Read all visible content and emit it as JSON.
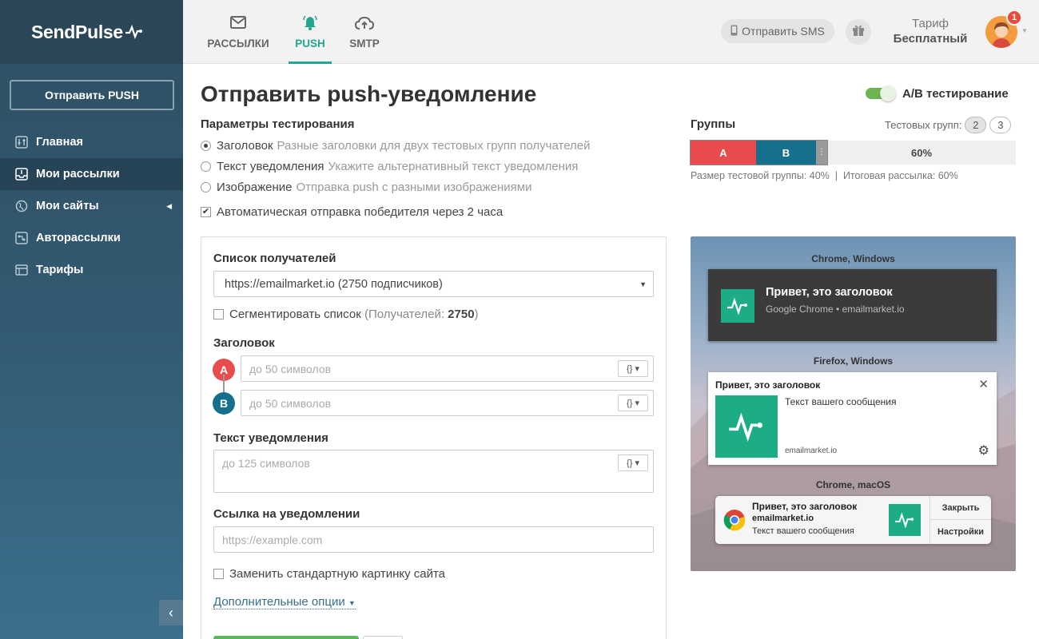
{
  "brand": {
    "name": "SendPulse"
  },
  "sidebar": {
    "send_button": "Отправить PUSH",
    "items": [
      {
        "label": "Главная",
        "icon": "sliders-icon"
      },
      {
        "label": "Мои рассылки",
        "icon": "inbox-icon",
        "active": true
      },
      {
        "label": "Мои сайты",
        "icon": "globe-icon"
      },
      {
        "label": "Авторассылки",
        "icon": "automation-icon"
      },
      {
        "label": "Тарифы",
        "icon": "tariff-icon"
      }
    ],
    "collapse_icon": "chevron-left-icon"
  },
  "topbar": {
    "tabs": [
      {
        "label": "РАССЫЛКИ",
        "icon": "envelope-icon"
      },
      {
        "label": "PUSH",
        "icon": "bell-icon",
        "active": true
      },
      {
        "label": "SMTP",
        "icon": "cloud-upload-icon"
      }
    ],
    "sms_button": "Отправить SMS",
    "tariff_label": "Тариф",
    "tariff_value": "Бесплатный",
    "notifications_count": "1"
  },
  "page": {
    "title": "Отправить push-уведомление",
    "ab_testing_label": "A/B тестирование",
    "ab_testing_on": true
  },
  "params": {
    "title": "Параметры тестирования",
    "options": [
      {
        "label": "Заголовок",
        "hint": "Разные заголовки для двух тестовых групп получателей",
        "checked": true
      },
      {
        "label": "Текст уведомления",
        "hint": "Укажите альтернативный текст уведомления",
        "checked": false
      },
      {
        "label": "Изображение",
        "hint": "Отправка push с разными изображениями",
        "checked": false
      }
    ],
    "auto_send": "Автоматическая отправка победителя через 2 часа"
  },
  "groups": {
    "title": "Группы",
    "test_groups_label": "Тестовых групп:",
    "counts": [
      "2",
      "3"
    ],
    "selected_count": "2",
    "seg_a": "A",
    "seg_b": "B",
    "final_label": "60%",
    "test_group_pct": 40,
    "info_test": "Размер тестовой группы: 40%",
    "info_sep": "|",
    "info_final": "Итоговая рассылка: 60%"
  },
  "form": {
    "recipients_label": "Список получателей",
    "recipients_value": "https://emailmarket.io (2750 подписчиков)",
    "segment_label": "Сегментировать список",
    "segment_open": "(",
    "segment_count_label": "Получателей:",
    "segment_count": "2750",
    "segment_close": ")",
    "title_label": "Заголовок",
    "variant_a": "A",
    "variant_b": "B",
    "title_placeholder": "до 50 символов",
    "var_button": "{}",
    "text_label": "Текст уведомления",
    "text_placeholder": "до 125 символов",
    "link_label": "Ссылка на уведомлении",
    "link_placeholder": "https://example.com",
    "replace_image": "Заменить стандартную картинку сайта",
    "more_options": "Дополнительные опции"
  },
  "preview": {
    "chrome_win_label": "Chrome, Windows",
    "chrome_win_title": "Привет, это заголовок",
    "chrome_win_source": "Google Chrome • emailmarket.io",
    "firefox_label": "Firefox, Windows",
    "firefox_title": "Привет, это заголовок",
    "firefox_text": "Текст вашего сообщения",
    "firefox_site": "emailmarket.io",
    "mac_label": "Chrome, macOS",
    "mac_title": "Привет, это заголовок",
    "mac_site": "emailmarket.io",
    "mac_text": "Текст вашего сообщения",
    "mac_close": "Закрыть",
    "mac_settings": "Настройки"
  },
  "colors": {
    "accent": "#22a78e",
    "group_a": "#e84c4c",
    "group_b": "#16708d",
    "toggle_on": "#6fb454"
  }
}
